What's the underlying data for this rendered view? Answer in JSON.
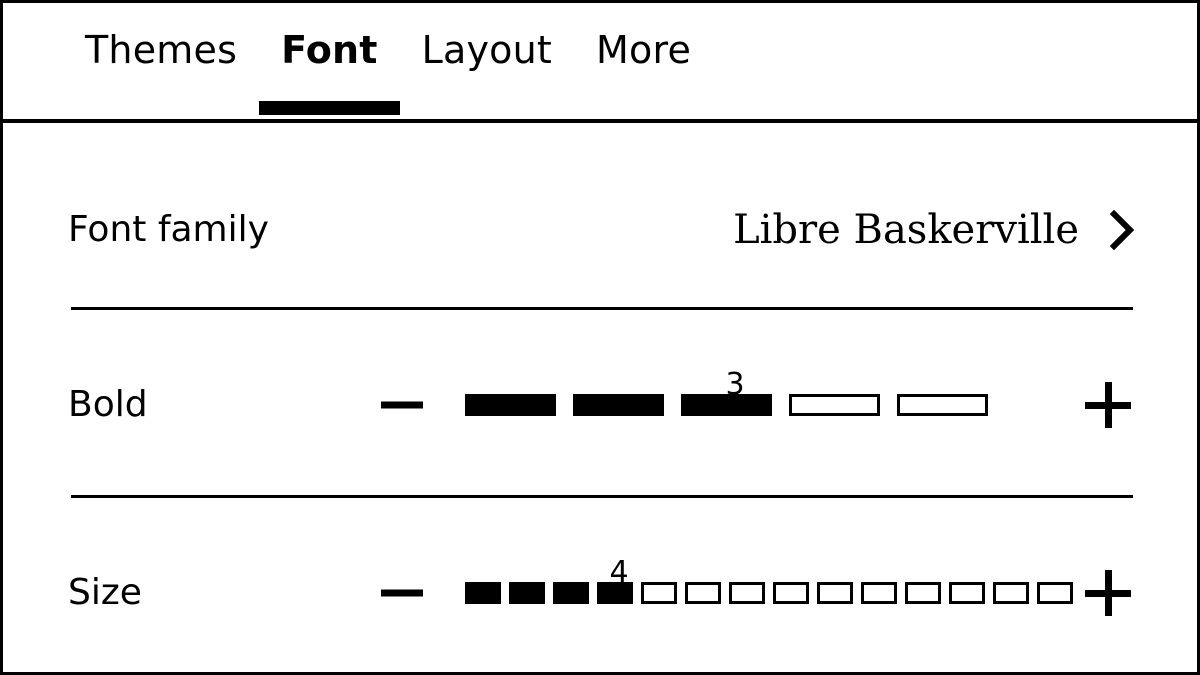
{
  "window": {
    "background": "#ffffff",
    "foreground": "#000000"
  },
  "tabs": {
    "items": [
      {
        "label": "Themes",
        "active": false
      },
      {
        "label": "Font",
        "active": true
      },
      {
        "label": "Layout",
        "active": false
      },
      {
        "label": "More",
        "active": false
      }
    ],
    "active_index": 1
  },
  "settings": {
    "font_family": {
      "label": "Font family",
      "value": "Libre Baskerville",
      "chevron_icon": "chevron-right-icon"
    },
    "bold": {
      "label": "Bold",
      "decrement_icon": "minus-icon",
      "increment_icon": "plus-icon",
      "value": 3,
      "value_text": "3",
      "min": 0,
      "max": 5,
      "segments": 5,
      "filled": 3
    },
    "size": {
      "label": "Size",
      "decrement_icon": "minus-icon",
      "increment_icon": "plus-icon",
      "value": 4,
      "value_text": "4",
      "min": 0,
      "max": 14,
      "segments": 14,
      "filled": 4
    }
  }
}
